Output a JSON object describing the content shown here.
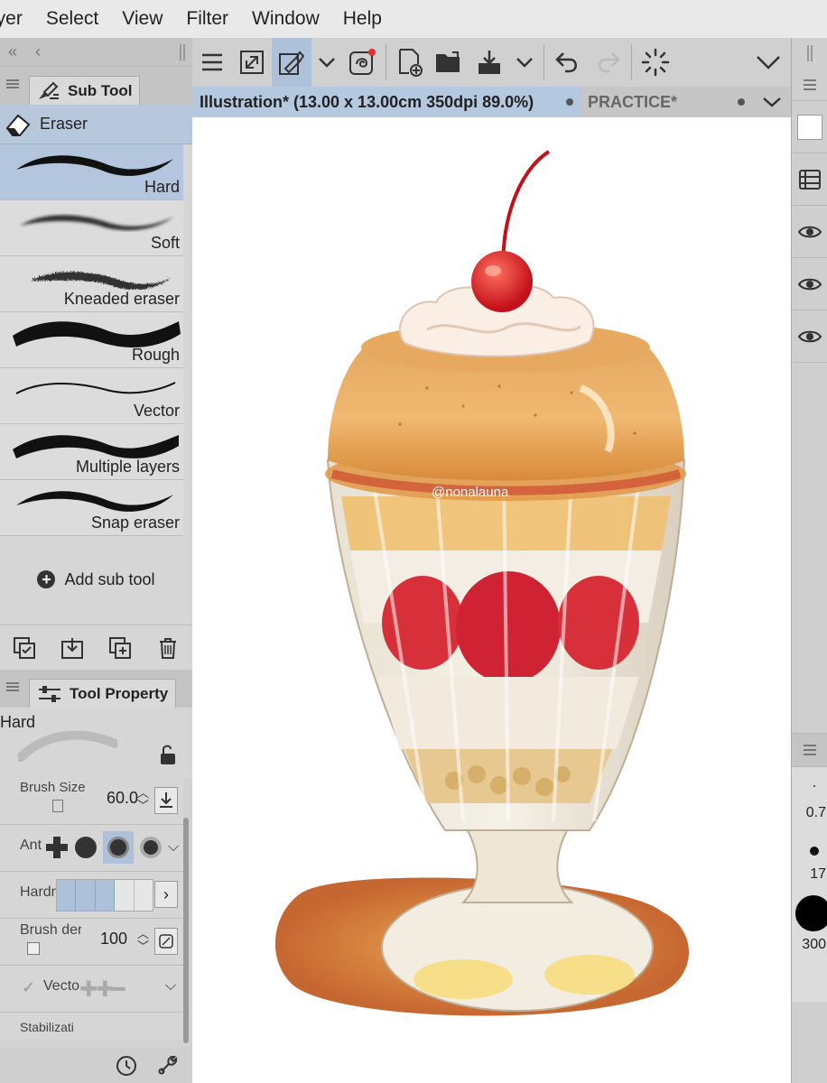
{
  "menu": [
    "ayer",
    "Select",
    "View",
    "Filter",
    "Window",
    "Help"
  ],
  "sub_tool_panel": {
    "title": "Sub Tool",
    "group": "Eraser",
    "items": [
      {
        "label": "Hard",
        "selected": true
      },
      {
        "label": "Soft",
        "selected": false
      },
      {
        "label": "Kneaded eraser",
        "selected": false
      },
      {
        "label": "Rough",
        "selected": false
      },
      {
        "label": "Vector",
        "selected": false
      },
      {
        "label": "Multiple layers",
        "selected": false
      },
      {
        "label": "Snap eraser",
        "selected": false
      }
    ],
    "add_label": "Add sub tool"
  },
  "tool_property": {
    "title": "Tool Property",
    "preset_name": "Hard",
    "brush_size_label": "Brush Size",
    "brush_size": "60.0",
    "anti_label": "Ant",
    "hardness_label": "Hardn",
    "hardness_level": 3,
    "brush_density_label": "Brush den",
    "brush_density": "100",
    "vector_label": "Vecto",
    "stabilization_label": "Stabilizati"
  },
  "document_tabs": [
    {
      "label": "Illustration* (13.00 x 13.00cm 350dpi 89.0%)",
      "active": true
    },
    {
      "label": "PRACTICE*",
      "active": false
    }
  ],
  "canvas": {
    "watermark": "@nonalauna"
  },
  "right_panel": {
    "brush_sizes": [
      "0.7",
      "17",
      "300"
    ]
  },
  "colors": {
    "selection_blue": "#b3c6de",
    "panel_gray": "#d6d6d6"
  }
}
